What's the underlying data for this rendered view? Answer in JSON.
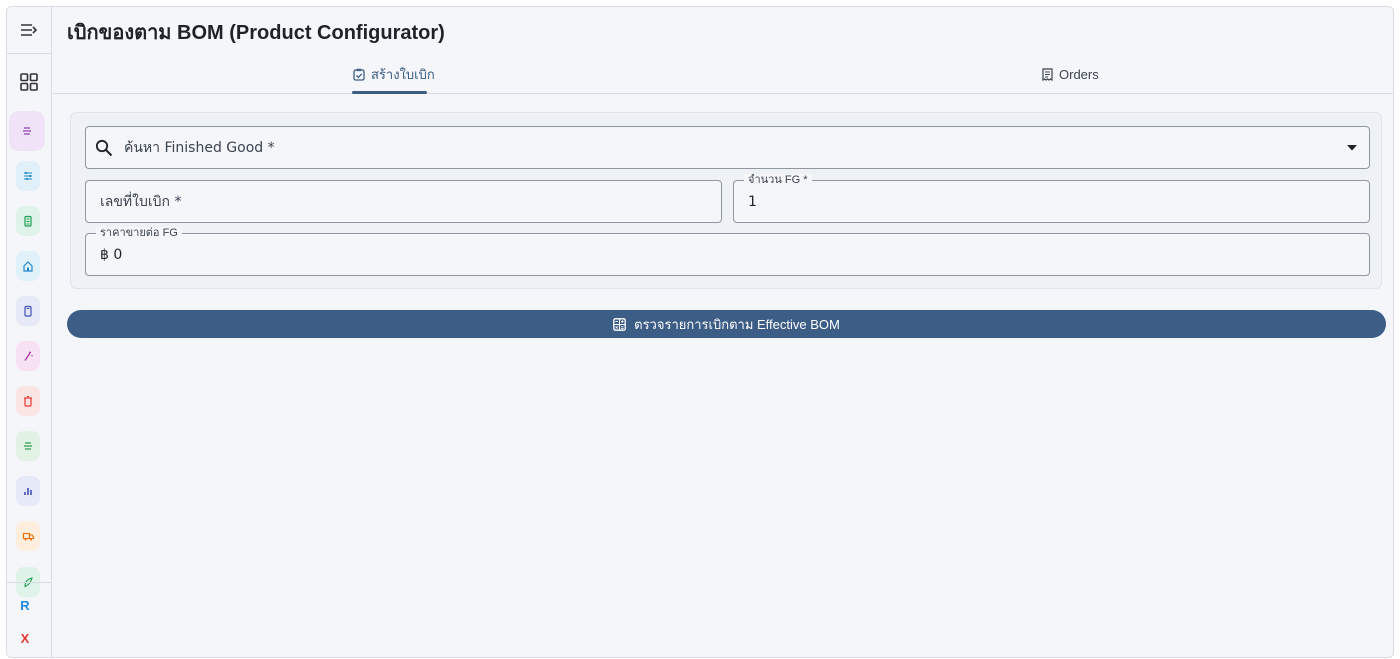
{
  "app": {
    "title": "เบิกของตาม BOM (Product Configurator)"
  },
  "sidebar": {
    "menu_icon": "menu-collapse-icon",
    "grid_icon": "apps-grid-icon",
    "items": [
      {
        "icon": "list-icon",
        "color": "#8e44ad",
        "bg": "#f0e3f8",
        "active": true
      },
      {
        "icon": "sliders-icon",
        "color": "#1e88c8",
        "bg": "#e1f1fa",
        "active": false
      },
      {
        "icon": "battery-icon",
        "color": "#1f9d55",
        "bg": "#e0f3e8",
        "active": false
      },
      {
        "icon": "home-icon",
        "color": "#1e88c8",
        "bg": "#e1f1fa",
        "active": false
      },
      {
        "icon": "device-icon",
        "color": "#3f51b5",
        "bg": "#e6e9f7",
        "active": false
      },
      {
        "icon": "wand-icon",
        "color": "#b03aa8",
        "bg": "#f6e2f4",
        "active": false
      },
      {
        "icon": "trash-icon",
        "color": "#e53935",
        "bg": "#fbe4e4",
        "active": false
      },
      {
        "icon": "list-icon",
        "color": "#2e9e4f",
        "bg": "#e2f3e6",
        "active": false
      },
      {
        "icon": "bar-chart-icon",
        "color": "#3f51b5",
        "bg": "#e6e9f7",
        "active": false
      },
      {
        "icon": "truck-icon",
        "color": "#ef6c00",
        "bg": "#fdeedd",
        "active": false
      },
      {
        "icon": "leaf-icon",
        "color": "#1f9d55",
        "bg": "#e0f3e8",
        "active": false
      }
    ],
    "bottom": [
      {
        "label": "R",
        "color": "#1e88e5"
      },
      {
        "label": "X",
        "color": "#e53935"
      }
    ]
  },
  "tabs": [
    {
      "label": "สร้างใบเบิก",
      "icon": "clipboard-check-icon",
      "active": true
    },
    {
      "label": "Orders",
      "icon": "receipt-icon",
      "active": false
    }
  ],
  "form": {
    "search": {
      "placeholder": "ค้นหา Finished Good *",
      "icon": "search-icon",
      "dropdown_icon": "caret-down-icon"
    },
    "doc_no": {
      "placeholder": "เลขที่ใบเบิก *"
    },
    "fg_qty": {
      "label": "จำนวน FG *",
      "value": "1"
    },
    "fg_price": {
      "label": "ราคาขายต่อ FG",
      "value": "฿ 0"
    }
  },
  "action": {
    "label": "ตรวจรายการเบิกตาม Effective BOM",
    "icon": "calculator-icon"
  },
  "colors": {
    "primary": "#3b5d86",
    "background": "#f4f6fa",
    "border": "#d9dde3"
  }
}
